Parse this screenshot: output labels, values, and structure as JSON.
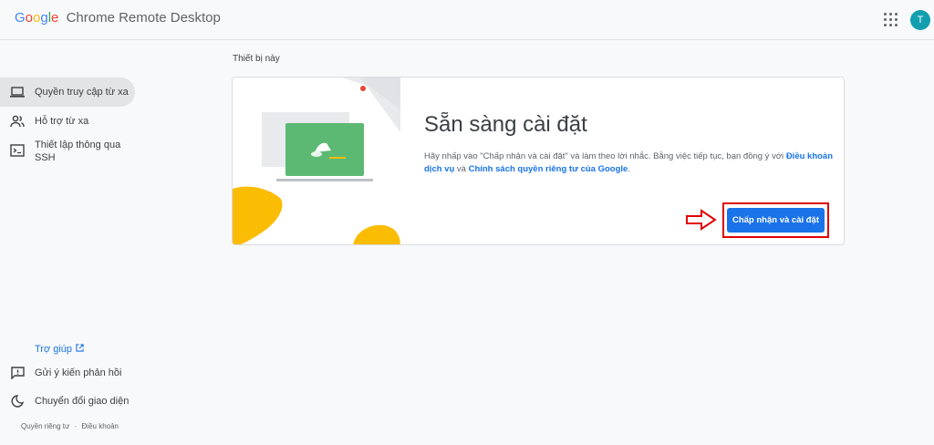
{
  "header": {
    "logo_letters": [
      "G",
      "o",
      "o",
      "g",
      "l",
      "e"
    ],
    "product_name": "Chrome Remote Desktop",
    "avatar_initial": "T"
  },
  "sidebar": {
    "items": [
      {
        "label": "Quyền truy cập từ xa",
        "icon": "laptop-icon",
        "active": true
      },
      {
        "label": "Hỗ trợ từ xa",
        "icon": "people-icon"
      },
      {
        "label": "Thiết lập thông qua SSH",
        "icon": "terminal-icon"
      }
    ],
    "help_link": "Trợ giúp",
    "feedback": "Gửi ý kiến phản hồi",
    "theme_toggle": "Chuyển đổi giao diện",
    "footer": {
      "privacy": "Quyền riêng tư",
      "separator": "·",
      "terms": "Điều khoản"
    }
  },
  "main": {
    "section_title": "Thiết bị này",
    "card": {
      "heading": "Sẵn sàng cài đặt",
      "desc_prefix": "Hãy nhấp vào \"Chấp nhận và cài đặt\" và làm theo lời nhắc. Bằng việc tiếp tục, bạn đồng ý với ",
      "terms_link": "Điều khoản dịch vụ",
      "desc_and": " và ",
      "privacy_link": "Chính sách quyền riêng tư của Google",
      "desc_suffix": ".",
      "accept_button": "Chấp nhận và cài đặt"
    }
  },
  "colors": {
    "accent": "#1a73e8",
    "annotation_red": "#e00000",
    "illus_green": "#5bb974",
    "illus_yellow": "#fbbc04",
    "avatar_bg": "#129eaf"
  }
}
